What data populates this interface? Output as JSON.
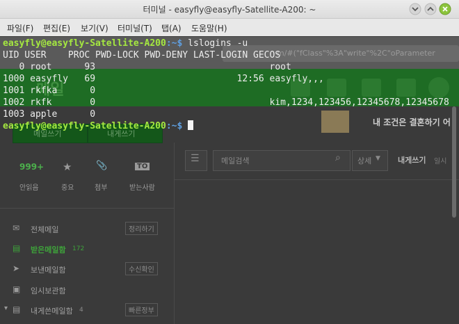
{
  "window": {
    "title": "터미널 - easyfly@easyfly-Satellite-A200: ~"
  },
  "menu": {
    "items": [
      "파일(F)",
      "편집(E)",
      "보기(V)",
      "터미널(T)",
      "탭(A)",
      "도움말(H)"
    ]
  },
  "terminal": {
    "prompt_user": "easyfly@easyfly-Satellite-A200",
    "prompt_dir": ":~$",
    "command": " lslogins -u",
    "header": "UID USER    PROC PWD-LOCK PWD-DENY LAST-LOGIN GECOS",
    "rows": [
      "   0 root      93                                root",
      "1000 easyfly   69                          12:56 easyfly,,,",
      "1001 rkfka      0",
      "1002 rkfk       0                                kim,1234,123456,12345678,12345678",
      "1003 apple      0"
    ],
    "prompt2_user": "easyfly@easyfly-Satellite-A200",
    "prompt2_dir": ":~$"
  },
  "background_page": {
    "url_fragment": "m/#(\"fClass\"%3A\"write\"%2C\"oParameter",
    "logo_text": "메일",
    "ad_text": "내 조건은 결혼하기 어",
    "btn_write": "메일쓰기",
    "btn_self": "내게쓰기",
    "quick": [
      {
        "value": "999+",
        "label": "안읽음"
      },
      {
        "value": "★",
        "label": "중요"
      },
      {
        "value": "📎",
        "label": "첨부"
      },
      {
        "value": "TO",
        "label": "받는사람"
      }
    ],
    "search_placeholder": "메일검색",
    "detail_label": "상세",
    "compose_self": "내게쓰기",
    "compose_self_sub": "일시",
    "folders": [
      {
        "label": "전체메일",
        "action": "정리하기"
      },
      {
        "label": "받은메일함",
        "count": "172"
      },
      {
        "label": "보낸메일함",
        "action": "수신확인"
      },
      {
        "label": "임시보관함"
      },
      {
        "label": "내게쓴메일함",
        "count": "4",
        "action": "빠른정부"
      }
    ],
    "colors": {
      "green": "#1e8a24",
      "green_dark": "#136b1a",
      "accent_green": "#3ea33a"
    }
  }
}
